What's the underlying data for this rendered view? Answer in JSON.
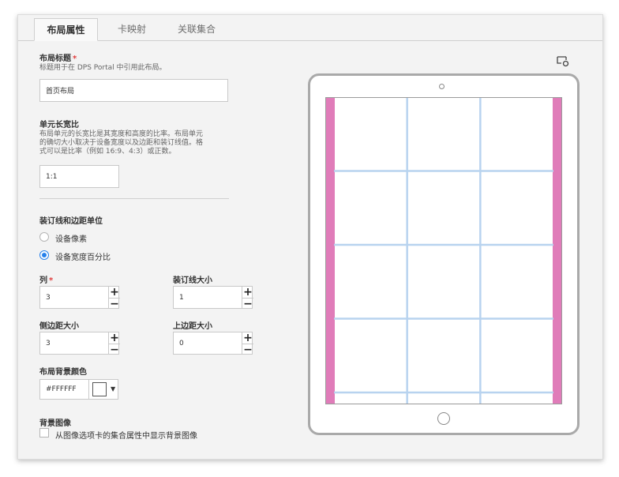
{
  "tabs": [
    {
      "label": "布局属性",
      "active": true
    },
    {
      "label": "卡映射",
      "active": false
    },
    {
      "label": "关联集合",
      "active": false
    }
  ],
  "layout_title": {
    "label": "布局标题",
    "required_mark": "*",
    "description": "标题用于在 DPS Portal 中引用此布局。",
    "value": "首页布局"
  },
  "cell_aspect": {
    "label": "单元长宽比",
    "description_lines": [
      "布局单元的长宽比是其宽度和高度的比率。布局单元",
      "的确切大小取决于设备宽度以及边距和装订线值。格",
      "式可以是比率（例如 16:9、4:3）或正数。"
    ],
    "value": "1:1"
  },
  "units": {
    "label": "装订线和边距单位",
    "options": [
      {
        "label": "设备像素",
        "selected": false
      },
      {
        "label": "设备宽度百分比",
        "selected": true
      }
    ]
  },
  "columns": {
    "label": "列",
    "required_mark": "*",
    "value": "3"
  },
  "gutter": {
    "label": "装订线大小",
    "value": "1"
  },
  "side_margin": {
    "label": "侧边距大小",
    "value": "3"
  },
  "top_margin": {
    "label": "上边距大小",
    "value": "0"
  },
  "bg_color": {
    "label": "布局背景颜色",
    "value": "#FFFFFF",
    "swatch": "#ffffff"
  },
  "bg_image": {
    "label": "背景图像",
    "checkbox_label": "从图像选项卡的集合属性中显示背景图像",
    "checked": false
  },
  "stepper": {
    "plus": "+",
    "minus": "−"
  },
  "colors": {
    "accent": "#2680eb",
    "margin_fill": "#e07cb9",
    "grid_line": "#b8d3ef",
    "device_frame": "#a9a9a9"
  },
  "preview": {
    "columns": 3,
    "visible_rows": 4,
    "icon": "preview-device-icon",
    "camera_icon": "device-camera",
    "home_button_icon": "device-home-button"
  }
}
